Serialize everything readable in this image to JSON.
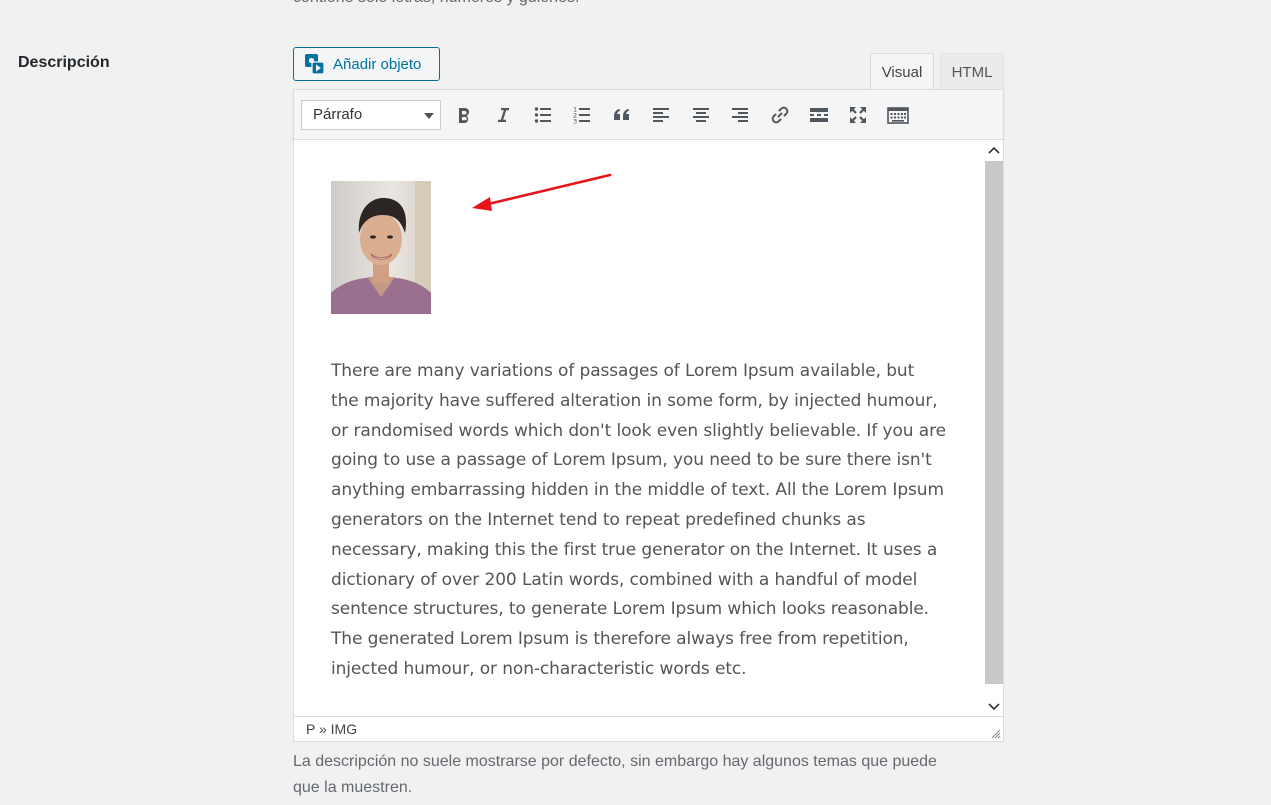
{
  "top_hint": "contiene solo letras, números y guiones.",
  "field_label": "Descripción",
  "add_media_button": {
    "label": "Añadir objeto",
    "icon": "add-media-icon"
  },
  "tabs": {
    "visual": "Visual",
    "html": "HTML"
  },
  "toolbar": {
    "format_select": {
      "selected": "Párrafo"
    },
    "buttons": [
      {
        "name": "bold",
        "icon": "bold-icon"
      },
      {
        "name": "italic",
        "icon": "italic-icon"
      },
      {
        "name": "bullet-list",
        "icon": "bullet-list-icon"
      },
      {
        "name": "numbered-list",
        "icon": "numbered-list-icon"
      },
      {
        "name": "blockquote",
        "icon": "blockquote-icon"
      },
      {
        "name": "align-left",
        "icon": "align-left-icon"
      },
      {
        "name": "align-center",
        "icon": "align-center-icon"
      },
      {
        "name": "align-right",
        "icon": "align-right-icon"
      },
      {
        "name": "insert-link",
        "icon": "link-icon"
      },
      {
        "name": "read-more",
        "icon": "read-more-icon"
      },
      {
        "name": "fullscreen",
        "icon": "fullscreen-icon"
      },
      {
        "name": "toolbar-toggle",
        "icon": "keyboard-icon"
      }
    ]
  },
  "editor": {
    "body_text": "There are many variations of passages of Lorem Ipsum available, but the majority have suffered alteration in some form, by injected humour, or randomised words which don't look even slightly believable. If you are going to use a passage of Lorem Ipsum, you need to be sure there isn't anything embarrassing hidden in the middle of text. All the Lorem Ipsum generators on the Internet tend to repeat predefined chunks as necessary, making this the first true generator on the Internet. It uses a dictionary of over 200 Latin words, combined with a handful of model sentence structures, to generate Lorem Ipsum which looks reasonable. The generated Lorem Ipsum is therefore always free from repetition, injected humour, or non-characteristic words etc.",
    "annotation_color": "#e8141b"
  },
  "status_bar": {
    "path": "P » IMG"
  },
  "help_text": "La descripción no suele mostrarse por defecto, sin embargo hay algunos temas que puede que la muestren.",
  "colors": {
    "accent": "#0071a1",
    "background": "#f1f1f1",
    "scroll_thumb": "#c8c8c8"
  }
}
